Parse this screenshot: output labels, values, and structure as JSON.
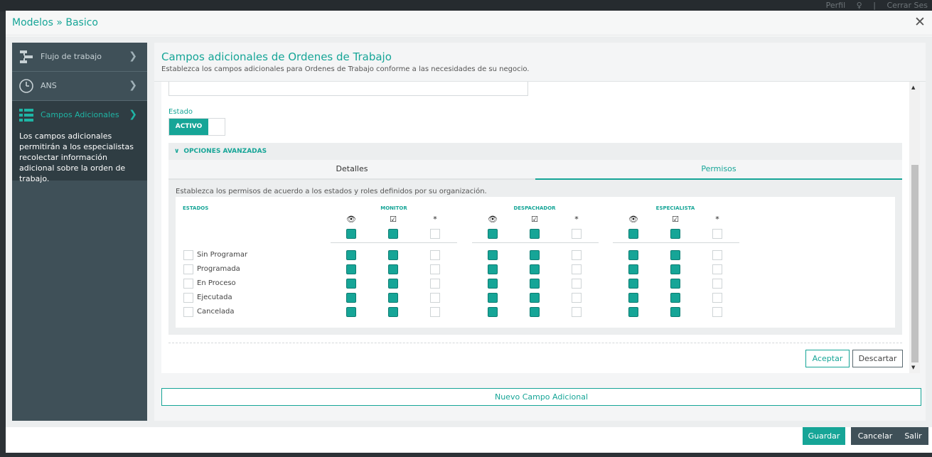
{
  "background": {
    "top_links": [
      "Perfil",
      "Cerrar Ses"
    ]
  },
  "modal": {
    "title": "Modelos » Basico",
    "close_label": "✕"
  },
  "sidebar": {
    "items": [
      {
        "label": "Flujo de trabajo",
        "icon": "workflow-icon"
      },
      {
        "label": "ANS",
        "icon": "clock-icon"
      },
      {
        "label": "Campos Adicionales",
        "icon": "list-icon",
        "active": true
      }
    ],
    "active_description": "Los campos adicionales permitirán a los especialistas recolectar información adicional sobre la orden de trabajo."
  },
  "main": {
    "title": "Campos adicionales de Ordenes de Trabajo",
    "subtitle": "Establezca los campos adicionales para Ordenes de Trabajo conforme a las necesidades de su negocio.",
    "estado_label": "Estado",
    "toggle_label": "ACTIVO",
    "toggle_on": true,
    "advanced_label": "OPCIONES AVANZADAS",
    "tabs": [
      {
        "label": "Detalles",
        "active": false
      },
      {
        "label": "Permisos",
        "active": true
      }
    ],
    "permissions_text": "Establezca los permisos de acuerdo a los estados y roles definidos por su organización.",
    "states_header": "ESTADOS",
    "roles": [
      "MONITOR",
      "DESPACHADOR",
      "ESPECIALISTA"
    ],
    "perm_icons": [
      "👁",
      "☑",
      "*"
    ],
    "states": [
      "Sin Programar",
      "Programada",
      "En Proceso",
      "Ejecutada",
      "Cancelada"
    ],
    "aceptar_label": "Aceptar",
    "descartar_label": "Descartar",
    "nuevo_label": "Nuevo Campo Adicional"
  },
  "footer": {
    "guardar_label": "Guardar",
    "cancelar_label": "Cancelar",
    "salir_label": "Salir"
  },
  "colors": {
    "accent": "#16a597",
    "sidebar": "#3f5058",
    "sidebar_active": "#2f3d43"
  }
}
